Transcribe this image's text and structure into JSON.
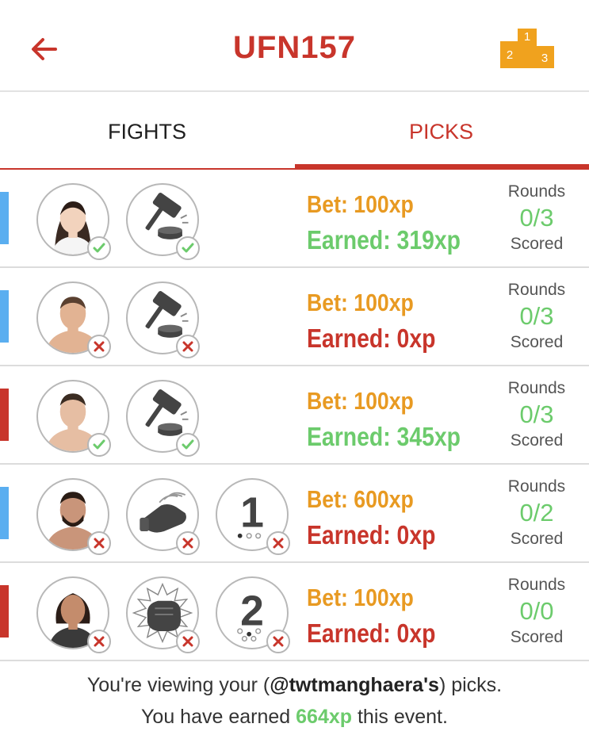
{
  "header": {
    "title": "UFN157",
    "back_icon": "arrow-left-icon",
    "leaderboard_icon": "podium-icon",
    "podium_places": [
      "1",
      "2",
      "3"
    ],
    "accent_color": "#c8352b",
    "podium_color": "#f0a21e"
  },
  "tabs": [
    {
      "label": "FIGHTS",
      "active": false
    },
    {
      "label": "PICKS",
      "active": true
    }
  ],
  "picks": [
    {
      "corner": "blue",
      "fighter_result": "correct",
      "method_icon": "gavel-icon",
      "method_result": "correct",
      "round_pick": null,
      "bet": "Bet: 100xp",
      "earned": "Earned: 319xp",
      "earned_status": "positive",
      "rounds_label": "Rounds",
      "rounds_value": "0/3",
      "scored_label": "Scored"
    },
    {
      "corner": "blue",
      "fighter_result": "wrong",
      "method_icon": "gavel-icon",
      "method_result": "wrong",
      "round_pick": null,
      "bet": "Bet: 100xp",
      "earned": "Earned: 0xp",
      "earned_status": "zero",
      "rounds_label": "Rounds",
      "rounds_value": "0/3",
      "scored_label": "Scored"
    },
    {
      "corner": "red",
      "fighter_result": "correct",
      "method_icon": "gavel-icon",
      "method_result": "correct",
      "round_pick": null,
      "bet": "Bet: 100xp",
      "earned": "Earned: 345xp",
      "earned_status": "positive",
      "rounds_label": "Rounds",
      "rounds_value": "0/3",
      "scored_label": "Scored"
    },
    {
      "corner": "blue",
      "fighter_result": "wrong",
      "method_icon": "glove-icon",
      "method_result": "wrong",
      "round_pick": "1",
      "round_result": "wrong",
      "bet": "Bet: 600xp",
      "earned": "Earned: 0xp",
      "earned_status": "zero",
      "rounds_label": "Rounds",
      "rounds_value": "0/2",
      "scored_label": "Scored"
    },
    {
      "corner": "red",
      "fighter_result": "wrong",
      "method_icon": "punch-icon",
      "method_result": "wrong",
      "round_pick": "2",
      "round_result": "wrong",
      "bet": "Bet: 100xp",
      "earned": "Earned: 0xp",
      "earned_status": "zero",
      "rounds_label": "Rounds",
      "rounds_value": "0/0",
      "scored_label": "Scored"
    }
  ],
  "footer": {
    "line1_prefix": "You're viewing your (",
    "handle": "@twtmanghaera's",
    "line1_suffix": ") picks.",
    "line2_prefix": "You have earned ",
    "total_xp": "664xp",
    "line2_suffix": " this event."
  },
  "colors": {
    "blue_corner": "#5aaef0",
    "red_corner": "#c8352b",
    "bet": "#e89a22",
    "earned_positive": "#6ccb6c",
    "earned_zero": "#c8352b"
  }
}
